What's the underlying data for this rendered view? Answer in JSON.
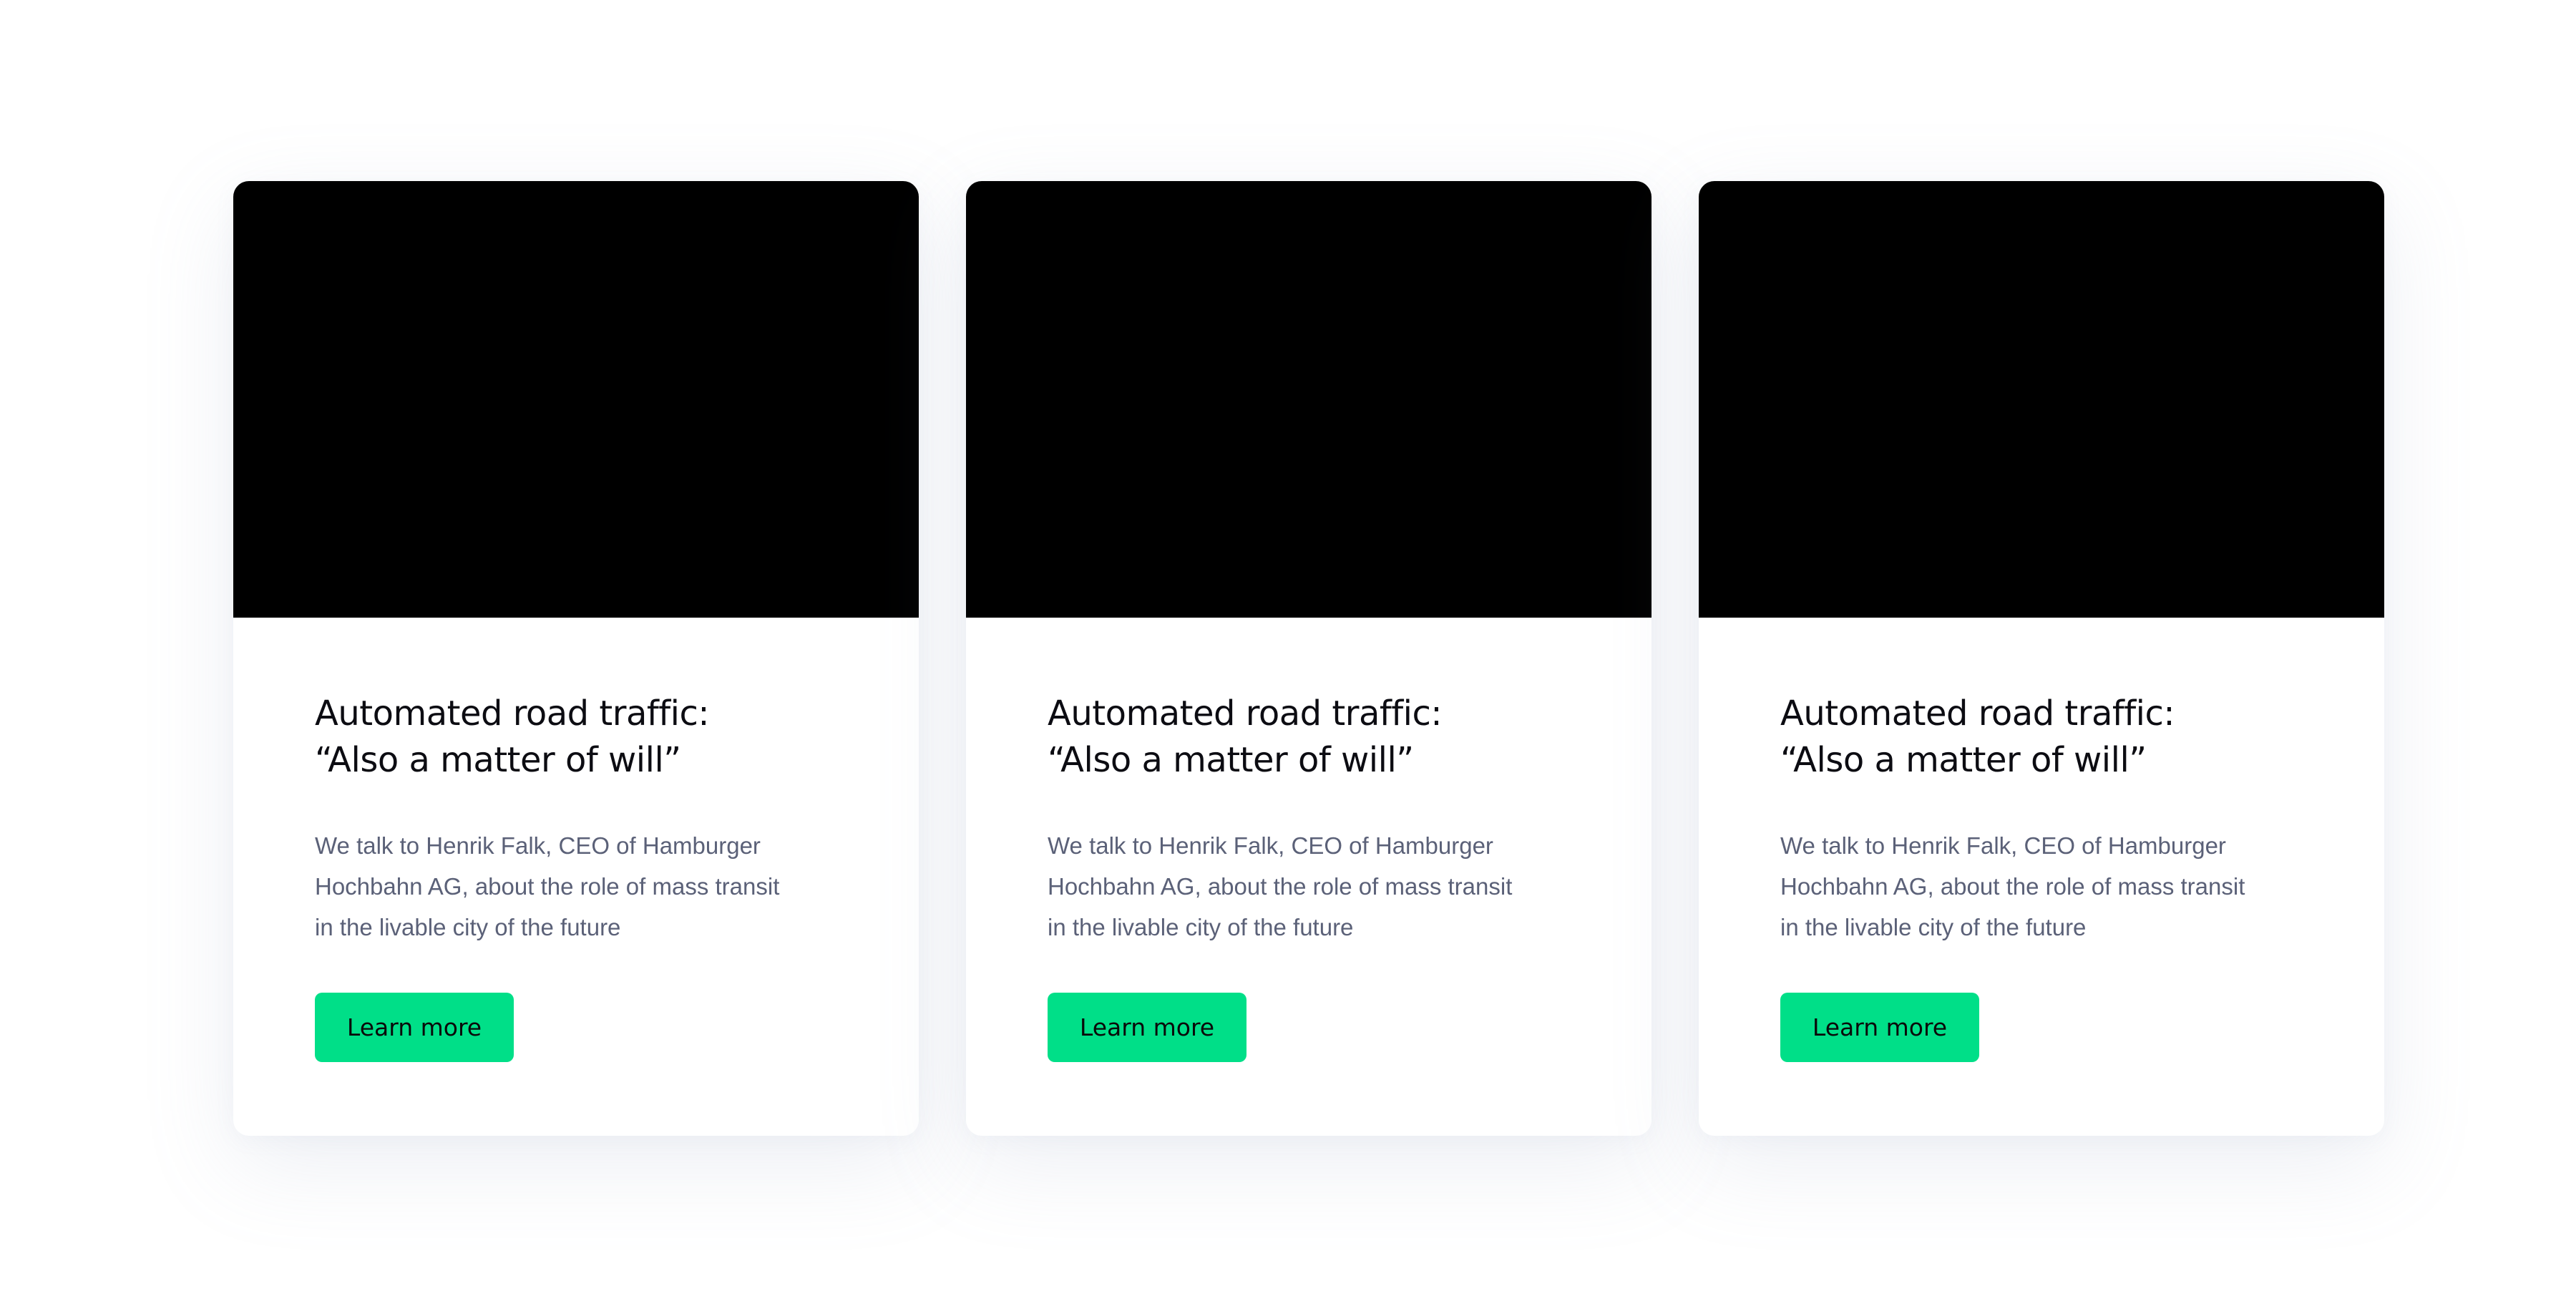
{
  "cards": [
    {
      "title_line1": "Automated road traffic:",
      "title_line2": "“Also a matter of will”",
      "desc_line1": "We talk to Henrik Falk, CEO of Hamburger",
      "desc_line2": "Hochbahn AG, about the role of mass transit",
      "desc_line3": "in the livable city of the future",
      "button_label": "Learn more"
    },
    {
      "title_line1": "Automated road traffic:",
      "title_line2": "“Also a matter of will”",
      "desc_line1": "We talk to Henrik Falk, CEO of Hamburger",
      "desc_line2": "Hochbahn AG, about the role of mass transit",
      "desc_line3": "in the livable city of the future",
      "button_label": "Learn more"
    },
    {
      "title_line1": "Automated road traffic:",
      "title_line2": "“Also a matter of will”",
      "desc_line1": "We talk to Henrik Falk, CEO of Hamburger",
      "desc_line2": "Hochbahn AG, about the role of mass transit",
      "desc_line3": "in the livable city of the future",
      "button_label": "Learn more"
    }
  ],
  "colors": {
    "accent": "#00df88",
    "media_placeholder": "#000000",
    "body_text": "#5b6178",
    "title_text": "#0c0c12"
  }
}
